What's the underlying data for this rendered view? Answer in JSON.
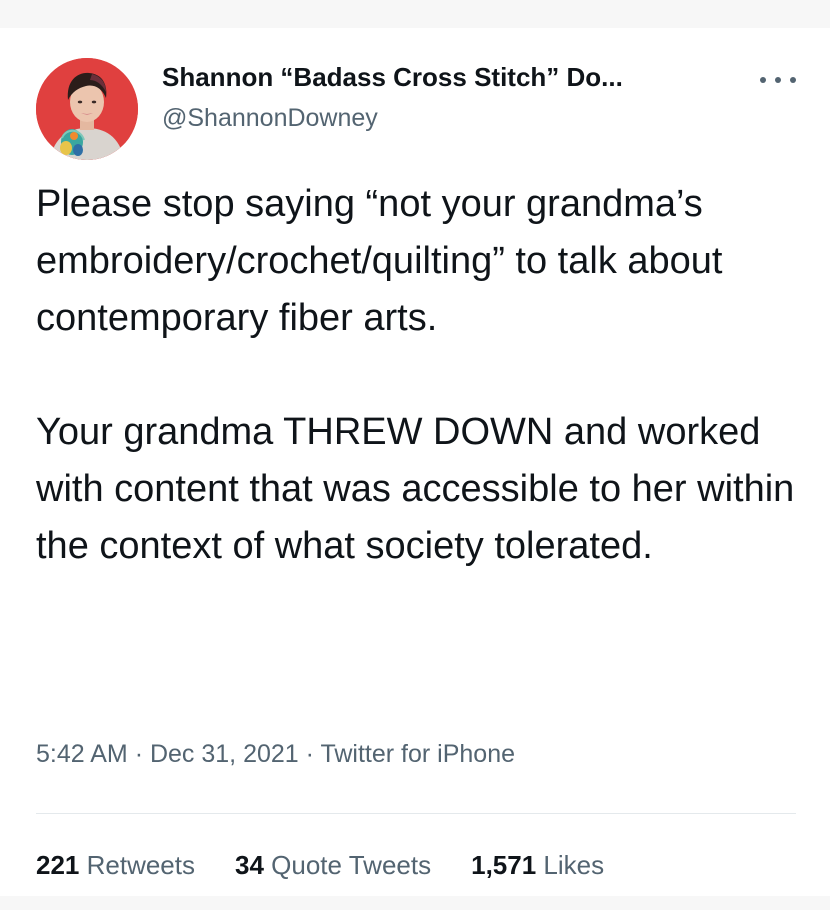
{
  "author": {
    "display_name": "Shannon “Badass Cross Stitch” Do...",
    "handle": "@ShannonDowney"
  },
  "tweet": {
    "paragraphs": [
      "Please stop saying “not your grandma’s embroidery/crochet/quilting” to talk about contemporary fiber arts.",
      "Your grandma THREW DOWN and worked with content that was accessible to her within the context of what society tolerated."
    ],
    "time": "5:42 AM",
    "date": "Dec 31, 2021",
    "source": "Twitter for iPhone",
    "separator": "·"
  },
  "stats": {
    "retweets_count": "221",
    "retweets_label": "Retweets",
    "quotes_count": "34",
    "quotes_label": "Quote Tweets",
    "likes_count": "1,571",
    "likes_label": "Likes"
  },
  "icons": {
    "more": "more-horizontal-icon"
  },
  "colors": {
    "text_primary": "#0f1419",
    "text_secondary": "#536471",
    "avatar_bg": "#e0403f"
  }
}
